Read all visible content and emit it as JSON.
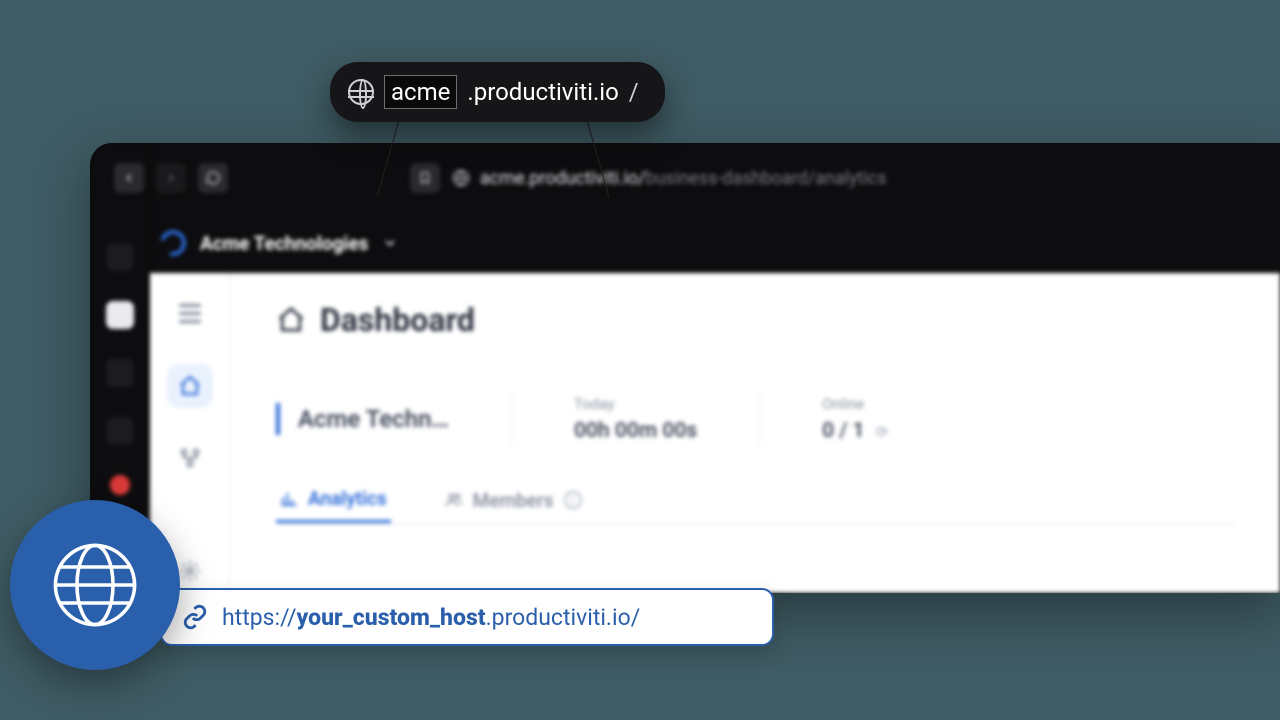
{
  "callout": {
    "subdomain": "acme",
    "domain": ".productiviti.io",
    "trailing": "/"
  },
  "address_bar": {
    "host": "acme.productiviti.io/",
    "path": "business-dashboard/analytics"
  },
  "workspace": {
    "name": "Acme Technologies"
  },
  "page": {
    "title": "Dashboard"
  },
  "stats": {
    "org": "Acme Techn…",
    "today_label": "Today",
    "today_value": "00h 00m 00s",
    "online_label": "Online",
    "online_value": "0 / 1"
  },
  "tabs": {
    "analytics": "Analytics",
    "members": "Members"
  },
  "custom_host": {
    "prefix": "https://",
    "placeholder": "your_custom_host",
    "suffix": ".productiviti.io/"
  }
}
